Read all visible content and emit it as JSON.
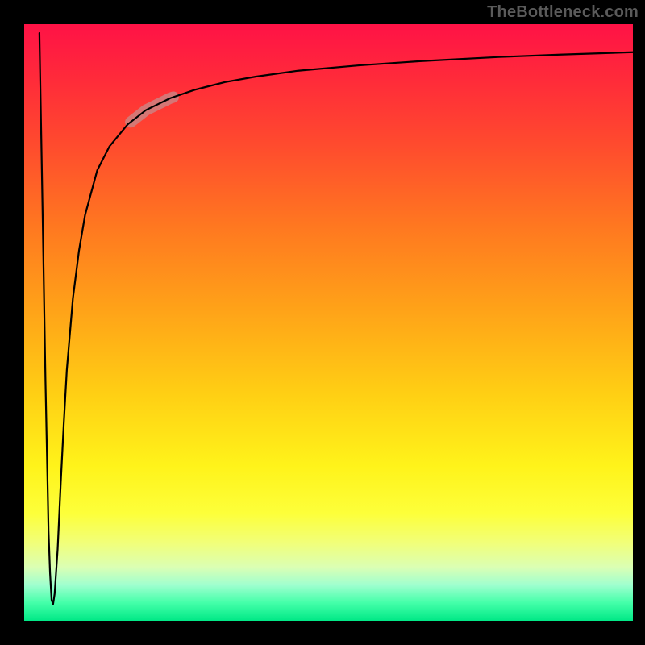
{
  "watermark": "TheBottleneck.com",
  "colors": {
    "frame": "#000000",
    "watermark_text": "#5a5a5a",
    "curve": "#000000",
    "highlight": "#c98888",
    "gradient_top": "#ff1246",
    "gradient_bottom": "#00e886"
  },
  "chart_data": {
    "type": "line",
    "title": "",
    "xlabel": "",
    "ylabel": "",
    "xlim": [
      0,
      100
    ],
    "ylim": [
      0,
      100
    ],
    "grid": false,
    "legend": false,
    "x": [
      2.5,
      3.0,
      3.5,
      4.0,
      4.25,
      4.5,
      4.75,
      5.0,
      5.5,
      6.0,
      6.5,
      7.0,
      8.0,
      9.0,
      10.0,
      12.0,
      14.0,
      17.0,
      20.0,
      24.0,
      28.0,
      33.0,
      38.0,
      45.0,
      55.0,
      65.0,
      78.0,
      88.0,
      100.0
    ],
    "values": [
      98.5,
      70.0,
      40.0,
      15.0,
      8.0,
      3.5,
      2.8,
      4.5,
      12.0,
      23.0,
      33.0,
      42.0,
      54.0,
      62.0,
      68.0,
      75.5,
      79.5,
      83.2,
      85.6,
      87.6,
      89.0,
      90.3,
      91.2,
      92.2,
      93.1,
      93.8,
      94.5,
      94.9,
      95.3
    ],
    "highlight_region": {
      "x_start": 17.5,
      "x_end": 24.5
    },
    "annotations": []
  }
}
